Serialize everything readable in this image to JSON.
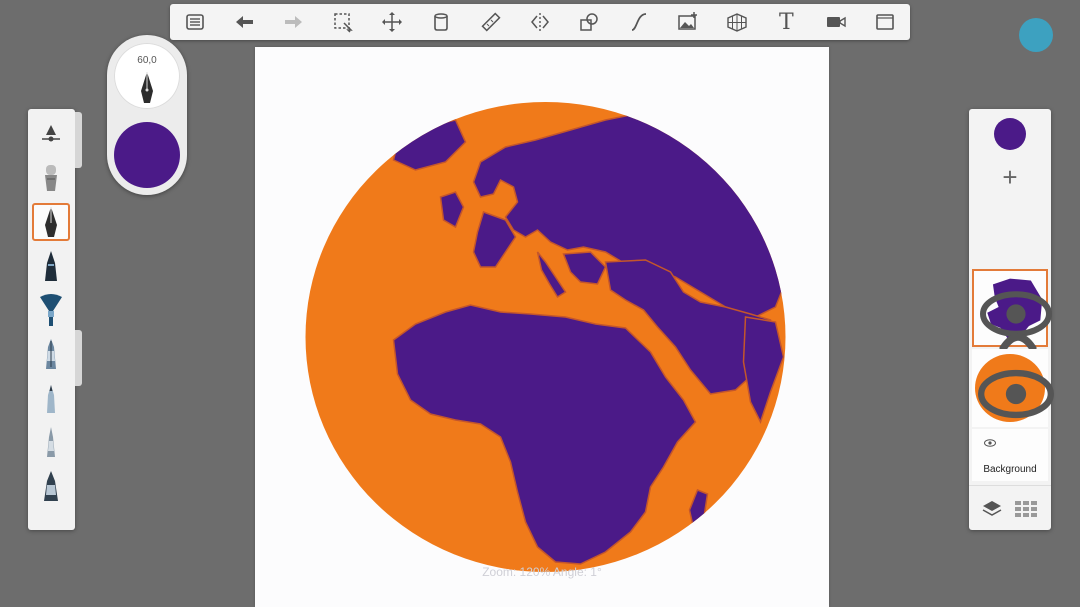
{
  "toolbar": {
    "items": [
      {
        "name": "gallery-menu-icon"
      },
      {
        "name": "undo-icon"
      },
      {
        "name": "redo-icon",
        "disabled": true
      },
      {
        "name": "selection-icon"
      },
      {
        "name": "transform-move-icon"
      },
      {
        "name": "fill-bucket-icon"
      },
      {
        "name": "ruler-icon"
      },
      {
        "name": "symmetry-icon"
      },
      {
        "name": "shapes-icon"
      },
      {
        "name": "curve-stroke-icon"
      },
      {
        "name": "add-image-icon"
      },
      {
        "name": "perspective-grid-icon"
      },
      {
        "name": "text-icon",
        "label": "T"
      },
      {
        "name": "video-icon"
      },
      {
        "name": "fullscreen-icon"
      }
    ]
  },
  "brush_puck": {
    "size_value": "60,0",
    "color": "#4b1a88"
  },
  "brush_palette": {
    "selected_index": 2,
    "tools": [
      {
        "name": "brush-settings-icon"
      },
      {
        "name": "airbrush-icon"
      },
      {
        "name": "pen-nib-icon"
      },
      {
        "name": "ink-pen-icon"
      },
      {
        "name": "fan-brush-icon"
      },
      {
        "name": "marker-icon"
      },
      {
        "name": "pencil-icon"
      },
      {
        "name": "fine-liner-icon"
      },
      {
        "name": "chisel-marker-icon"
      }
    ]
  },
  "canvas": {
    "zoom_status": "Zoom: 120%  Angle: 1°",
    "colors": {
      "land": "#4b1a88",
      "ocean": "#f07a1a",
      "paper": "#fcfcfd"
    }
  },
  "layers": {
    "active_color": "#4b1a88",
    "add_label": "+",
    "background_label": "Background",
    "items": [
      {
        "name": "land-layer",
        "selected": true
      },
      {
        "name": "ocean-layer",
        "selected": false
      }
    ]
  },
  "colors": {
    "app_bg": "#6d6d6d",
    "accent": "#e37b39",
    "badge": "#37a6c9"
  }
}
